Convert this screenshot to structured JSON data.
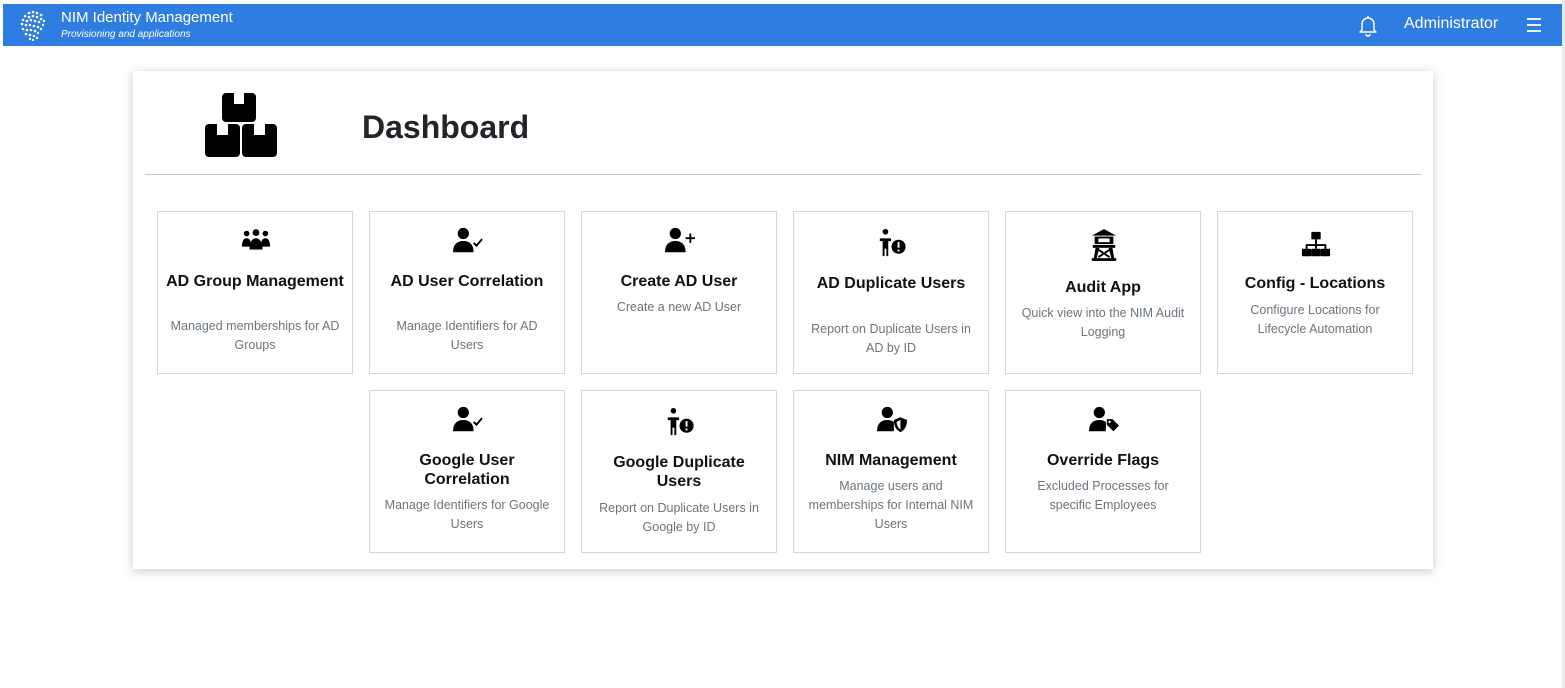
{
  "header": {
    "title": "NIM Identity Management",
    "subtitle": "Provisioning and applications",
    "user": "Administrator",
    "bg_color": "#2f7de1"
  },
  "page": {
    "title": "Dashboard"
  },
  "cards": [
    {
      "title": "AD Group Management",
      "description": "Managed memberships for AD Groups",
      "icon": "users-group-icon"
    },
    {
      "title": "AD User Correlation",
      "description": "Manage Identifiers for AD Users",
      "icon": "user-check-icon"
    },
    {
      "title": "Create AD User",
      "description": "Create a new AD User",
      "icon": "user-plus-icon"
    },
    {
      "title": "AD Duplicate Users",
      "description": "Report on Duplicate Users in AD by ID",
      "icon": "person-alert-icon"
    },
    {
      "title": "Audit App",
      "description": "Quick view into the NIM Audit Logging",
      "icon": "watchtower-icon"
    },
    {
      "title": "Config - Locations",
      "description": "Configure Locations for Lifecycle Automation",
      "icon": "sitemap-icon"
    },
    {
      "title": "Google User Correlation",
      "description": "Manage Identifiers for Google Users",
      "icon": "user-check-icon"
    },
    {
      "title": "Google Duplicate Users",
      "description": "Report on Duplicate Users in Google by ID",
      "icon": "person-alert-icon"
    },
    {
      "title": "NIM Management",
      "description": "Manage users and memberships for Internal NIM Users",
      "icon": "user-shield-icon"
    },
    {
      "title": "Override Flags",
      "description": "Excluded Processes for specific Employees",
      "icon": "user-tag-icon"
    }
  ]
}
